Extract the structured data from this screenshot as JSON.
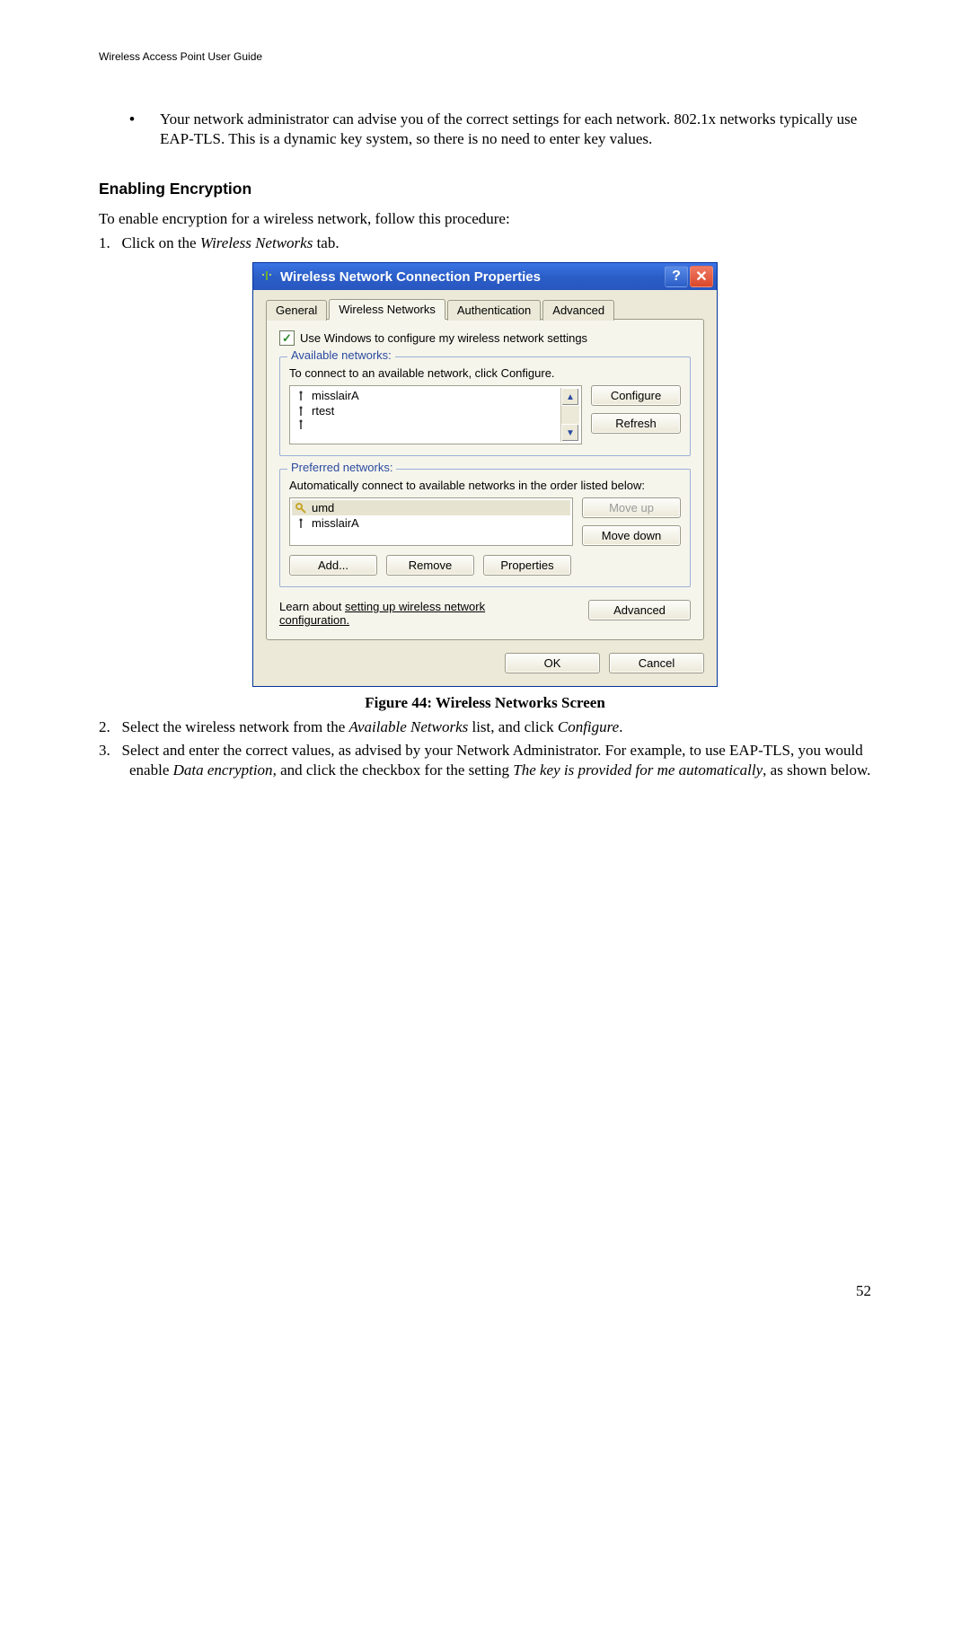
{
  "header": {
    "running_title": "Wireless Access Point User Guide"
  },
  "body": {
    "bullet": "Your network administrator can advise you of the correct settings for each network. 802.1x networks typically use EAP-TLS. This is a dynamic key system, so there is no need to enter key values.",
    "section_heading": "Enabling Encryption",
    "intro": "To enable encryption for a wireless network, follow this procedure:",
    "step1_prefix": "1.",
    "step1_a": "Click on the ",
    "step1_i": "Wireless Networks",
    "step1_b": " tab.",
    "figure_caption": "Figure 44: Wireless Networks Screen",
    "step2_prefix": "2.",
    "step2_a": "Select the wireless network from the ",
    "step2_i1": "Available Networks",
    "step2_b": " list, and click ",
    "step2_i2": "Configure",
    "step2_c": ".",
    "step3_prefix": "3.",
    "step3_a": "Select and enter the correct values, as advised by your Network Administrator. For example, to use EAP-TLS, you would enable ",
    "step3_i1": "Data encryption",
    "step3_b": ", and click the checkbox for the setting ",
    "step3_i2": "The key is provided for me automatically",
    "step3_c": ", as shown below.",
    "page_number": "52"
  },
  "dialog": {
    "title": "Wireless Network Connection Properties",
    "help_glyph": "?",
    "close_glyph": "✕",
    "tabs": {
      "general": "General",
      "wireless": "Wireless Networks",
      "auth": "Authentication",
      "advanced_tab": "Advanced"
    },
    "use_windows_check": "✓",
    "use_windows_label": "Use Windows to configure my wireless network settings",
    "available": {
      "legend": "Available networks:",
      "desc": "To connect to an available network, click Configure.",
      "items": [
        "misslairA",
        "rtest",
        ""
      ],
      "configure_btn": "Configure",
      "refresh_btn": "Refresh"
    },
    "preferred": {
      "legend": "Preferred networks:",
      "desc": "Automatically connect to available networks in the order listed below:",
      "items": [
        "umd",
        "misslairA"
      ],
      "moveup_btn": "Move up",
      "movedown_btn": "Move down",
      "add_btn": "Add...",
      "remove_btn": "Remove",
      "properties_btn": "Properties"
    },
    "learn_a": "Learn about ",
    "learn_link1": "setting up wireless network",
    "learn_link2": "configuration.",
    "advanced_btn": "Advanced",
    "ok_btn": "OK",
    "cancel_btn": "Cancel"
  }
}
